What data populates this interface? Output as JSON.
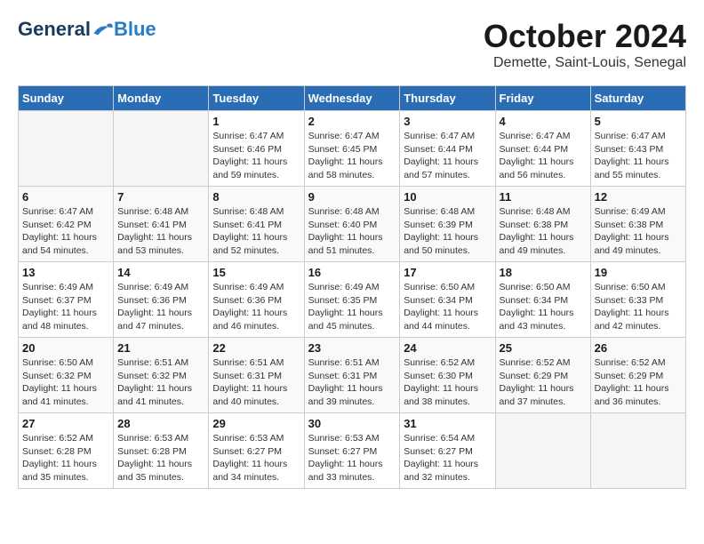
{
  "logo": {
    "general": "General",
    "blue": "Blue"
  },
  "title": "October 2024",
  "subtitle": "Demette, Saint-Louis, Senegal",
  "days_of_week": [
    "Sunday",
    "Monday",
    "Tuesday",
    "Wednesday",
    "Thursday",
    "Friday",
    "Saturday"
  ],
  "weeks": [
    [
      {
        "day": "",
        "empty": true
      },
      {
        "day": "",
        "empty": true
      },
      {
        "day": "1",
        "sunrise": "Sunrise: 6:47 AM",
        "sunset": "Sunset: 6:46 PM",
        "daylight": "Daylight: 11 hours and 59 minutes."
      },
      {
        "day": "2",
        "sunrise": "Sunrise: 6:47 AM",
        "sunset": "Sunset: 6:45 PM",
        "daylight": "Daylight: 11 hours and 58 minutes."
      },
      {
        "day": "3",
        "sunrise": "Sunrise: 6:47 AM",
        "sunset": "Sunset: 6:44 PM",
        "daylight": "Daylight: 11 hours and 57 minutes."
      },
      {
        "day": "4",
        "sunrise": "Sunrise: 6:47 AM",
        "sunset": "Sunset: 6:44 PM",
        "daylight": "Daylight: 11 hours and 56 minutes."
      },
      {
        "day": "5",
        "sunrise": "Sunrise: 6:47 AM",
        "sunset": "Sunset: 6:43 PM",
        "daylight": "Daylight: 11 hours and 55 minutes."
      }
    ],
    [
      {
        "day": "6",
        "sunrise": "Sunrise: 6:47 AM",
        "sunset": "Sunset: 6:42 PM",
        "daylight": "Daylight: 11 hours and 54 minutes."
      },
      {
        "day": "7",
        "sunrise": "Sunrise: 6:48 AM",
        "sunset": "Sunset: 6:41 PM",
        "daylight": "Daylight: 11 hours and 53 minutes."
      },
      {
        "day": "8",
        "sunrise": "Sunrise: 6:48 AM",
        "sunset": "Sunset: 6:41 PM",
        "daylight": "Daylight: 11 hours and 52 minutes."
      },
      {
        "day": "9",
        "sunrise": "Sunrise: 6:48 AM",
        "sunset": "Sunset: 6:40 PM",
        "daylight": "Daylight: 11 hours and 51 minutes."
      },
      {
        "day": "10",
        "sunrise": "Sunrise: 6:48 AM",
        "sunset": "Sunset: 6:39 PM",
        "daylight": "Daylight: 11 hours and 50 minutes."
      },
      {
        "day": "11",
        "sunrise": "Sunrise: 6:48 AM",
        "sunset": "Sunset: 6:38 PM",
        "daylight": "Daylight: 11 hours and 49 minutes."
      },
      {
        "day": "12",
        "sunrise": "Sunrise: 6:49 AM",
        "sunset": "Sunset: 6:38 PM",
        "daylight": "Daylight: 11 hours and 49 minutes."
      }
    ],
    [
      {
        "day": "13",
        "sunrise": "Sunrise: 6:49 AM",
        "sunset": "Sunset: 6:37 PM",
        "daylight": "Daylight: 11 hours and 48 minutes."
      },
      {
        "day": "14",
        "sunrise": "Sunrise: 6:49 AM",
        "sunset": "Sunset: 6:36 PM",
        "daylight": "Daylight: 11 hours and 47 minutes."
      },
      {
        "day": "15",
        "sunrise": "Sunrise: 6:49 AM",
        "sunset": "Sunset: 6:36 PM",
        "daylight": "Daylight: 11 hours and 46 minutes."
      },
      {
        "day": "16",
        "sunrise": "Sunrise: 6:49 AM",
        "sunset": "Sunset: 6:35 PM",
        "daylight": "Daylight: 11 hours and 45 minutes."
      },
      {
        "day": "17",
        "sunrise": "Sunrise: 6:50 AM",
        "sunset": "Sunset: 6:34 PM",
        "daylight": "Daylight: 11 hours and 44 minutes."
      },
      {
        "day": "18",
        "sunrise": "Sunrise: 6:50 AM",
        "sunset": "Sunset: 6:34 PM",
        "daylight": "Daylight: 11 hours and 43 minutes."
      },
      {
        "day": "19",
        "sunrise": "Sunrise: 6:50 AM",
        "sunset": "Sunset: 6:33 PM",
        "daylight": "Daylight: 11 hours and 42 minutes."
      }
    ],
    [
      {
        "day": "20",
        "sunrise": "Sunrise: 6:50 AM",
        "sunset": "Sunset: 6:32 PM",
        "daylight": "Daylight: 11 hours and 41 minutes."
      },
      {
        "day": "21",
        "sunrise": "Sunrise: 6:51 AM",
        "sunset": "Sunset: 6:32 PM",
        "daylight": "Daylight: 11 hours and 41 minutes."
      },
      {
        "day": "22",
        "sunrise": "Sunrise: 6:51 AM",
        "sunset": "Sunset: 6:31 PM",
        "daylight": "Daylight: 11 hours and 40 minutes."
      },
      {
        "day": "23",
        "sunrise": "Sunrise: 6:51 AM",
        "sunset": "Sunset: 6:31 PM",
        "daylight": "Daylight: 11 hours and 39 minutes."
      },
      {
        "day": "24",
        "sunrise": "Sunrise: 6:52 AM",
        "sunset": "Sunset: 6:30 PM",
        "daylight": "Daylight: 11 hours and 38 minutes."
      },
      {
        "day": "25",
        "sunrise": "Sunrise: 6:52 AM",
        "sunset": "Sunset: 6:29 PM",
        "daylight": "Daylight: 11 hours and 37 minutes."
      },
      {
        "day": "26",
        "sunrise": "Sunrise: 6:52 AM",
        "sunset": "Sunset: 6:29 PM",
        "daylight": "Daylight: 11 hours and 36 minutes."
      }
    ],
    [
      {
        "day": "27",
        "sunrise": "Sunrise: 6:52 AM",
        "sunset": "Sunset: 6:28 PM",
        "daylight": "Daylight: 11 hours and 35 minutes."
      },
      {
        "day": "28",
        "sunrise": "Sunrise: 6:53 AM",
        "sunset": "Sunset: 6:28 PM",
        "daylight": "Daylight: 11 hours and 35 minutes."
      },
      {
        "day": "29",
        "sunrise": "Sunrise: 6:53 AM",
        "sunset": "Sunset: 6:27 PM",
        "daylight": "Daylight: 11 hours and 34 minutes."
      },
      {
        "day": "30",
        "sunrise": "Sunrise: 6:53 AM",
        "sunset": "Sunset: 6:27 PM",
        "daylight": "Daylight: 11 hours and 33 minutes."
      },
      {
        "day": "31",
        "sunrise": "Sunrise: 6:54 AM",
        "sunset": "Sunset: 6:27 PM",
        "daylight": "Daylight: 11 hours and 32 minutes."
      },
      {
        "day": "",
        "empty": true
      },
      {
        "day": "",
        "empty": true
      }
    ]
  ]
}
